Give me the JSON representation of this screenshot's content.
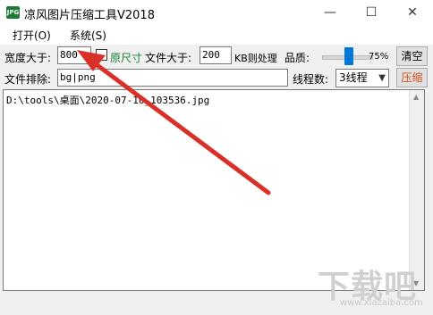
{
  "window": {
    "title": "凉风图片压缩工具V2018",
    "icon_label": "JPG",
    "min_glyph": "—",
    "max_glyph": "☐",
    "close_glyph": "✕"
  },
  "menu": {
    "open": "打开(O)",
    "system": "系统(S)"
  },
  "row1": {
    "width_label": "宽度大于:",
    "width_value": "800",
    "original_size_label": "原尺寸",
    "file_size_label": "文件大于:",
    "file_size_value": "200",
    "kb_label": "KB则处理",
    "quality_label": "品质:",
    "quality_percent": "75%",
    "clear_button": "清空"
  },
  "row2": {
    "exclude_label": "文件排除:",
    "exclude_value": "bg|png",
    "threads_label": "线程数:",
    "threads_value": "3线程",
    "compress_button": "压缩"
  },
  "file_list": [
    "D:\\tools\\桌面\\2020-07-10_103536.jpg"
  ],
  "watermark": {
    "main": "下载吧",
    "sub": "www.xiazaiba.com"
  },
  "colors": {
    "accent": "#0078d7",
    "annotation_arrow": "#d9302a",
    "compress_text": "#d24e1c",
    "original_size_text": "#1a7f37"
  }
}
